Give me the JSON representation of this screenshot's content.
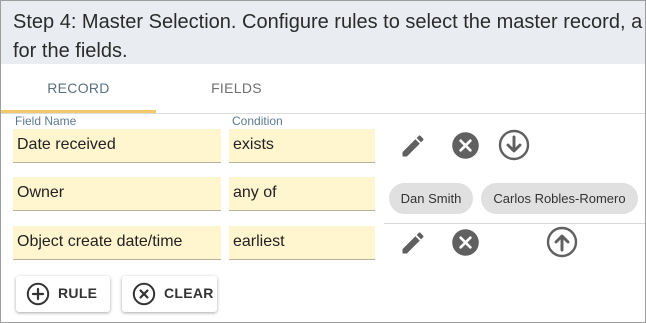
{
  "header": {
    "instructions": "Step 4: Master Selection. Configure rules to select the master record, a\nfor the fields."
  },
  "tabs": [
    {
      "label": "RECORD",
      "active": true
    },
    {
      "label": "FIELDS",
      "active": false
    }
  ],
  "columns": {
    "field_name": "Field Name",
    "condition": "Condition"
  },
  "rules": [
    {
      "field": "Date received",
      "condition": "exists",
      "actions": [
        "edit-icon",
        "remove-icon",
        "move-down-icon"
      ]
    },
    {
      "field": "Owner",
      "condition": "any of",
      "values": [
        "Dan Smith",
        "Carlos Robles-Romero"
      ]
    },
    {
      "field": "Object create date/time",
      "condition": "earliest",
      "actions": [
        "edit-icon",
        "remove-icon",
        "move-up-icon"
      ]
    }
  ],
  "buttons": {
    "add_rule": "RULE",
    "clear": "CLEAR"
  },
  "colors": {
    "header_bg": "#e9edf1",
    "active_tab_underline": "#f2c96b",
    "field_bg": "#fff5cf",
    "icon": "#606060",
    "chip_bg": "#e0e0e0"
  }
}
